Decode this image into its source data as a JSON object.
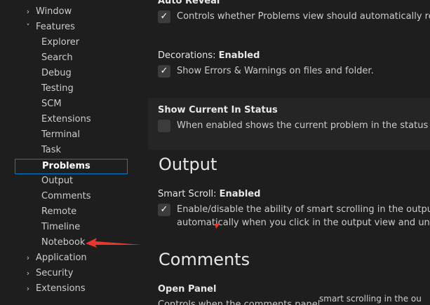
{
  "sidebar": {
    "items": [
      {
        "label": "Window",
        "level": 0,
        "expanded": false
      },
      {
        "label": "Features",
        "level": 0,
        "expanded": true
      },
      {
        "label": "Explorer",
        "level": 1
      },
      {
        "label": "Search",
        "level": 1
      },
      {
        "label": "Debug",
        "level": 1
      },
      {
        "label": "Testing",
        "level": 1
      },
      {
        "label": "SCM",
        "level": 1
      },
      {
        "label": "Extensions",
        "level": 1
      },
      {
        "label": "Terminal",
        "level": 1
      },
      {
        "label": "Task",
        "level": 1
      },
      {
        "label": "Problems",
        "level": 1,
        "selected": true
      },
      {
        "label": "Output",
        "level": 1
      },
      {
        "label": "Comments",
        "level": 1
      },
      {
        "label": "Remote",
        "level": 1
      },
      {
        "label": "Timeline",
        "level": 1
      },
      {
        "label": "Notebook",
        "level": 1
      },
      {
        "label": "Application",
        "level": 0,
        "expanded": false
      },
      {
        "label": "Security",
        "level": 0,
        "expanded": false
      },
      {
        "label": "Extensions",
        "level": 0,
        "expanded": false
      }
    ]
  },
  "settings": {
    "auto_reveal": {
      "title": "Auto Reveal",
      "checked": true,
      "description": "Controls whether Problems view should automatically reveal files"
    },
    "decorations": {
      "category": "Decorations: ",
      "name": "Enabled",
      "checked": true,
      "description": "Show Errors & Warnings on files and folder."
    },
    "show_current": {
      "title": "Show Current In Status",
      "checked": false,
      "description": "When enabled shows the current problem in the status bar."
    },
    "output_section": "Output",
    "smart_scroll": {
      "category": "Smart Scroll: ",
      "name": "Enabled",
      "checked": true,
      "description_line1": "Enable/disable the ability of smart scrolling in the output view.",
      "description_line2": "automatically when you click in the output view and unlocks wh"
    },
    "comments_section": "Comments",
    "open_panel": {
      "title": "Open Panel",
      "description": "Controls when the comments panel shoul"
    },
    "hover_tip": "smart scrolling in the ou"
  },
  "colors": {
    "background": "#1e1e1e",
    "selection_border": "#007fd4",
    "annotation_red": "#e8372c"
  }
}
